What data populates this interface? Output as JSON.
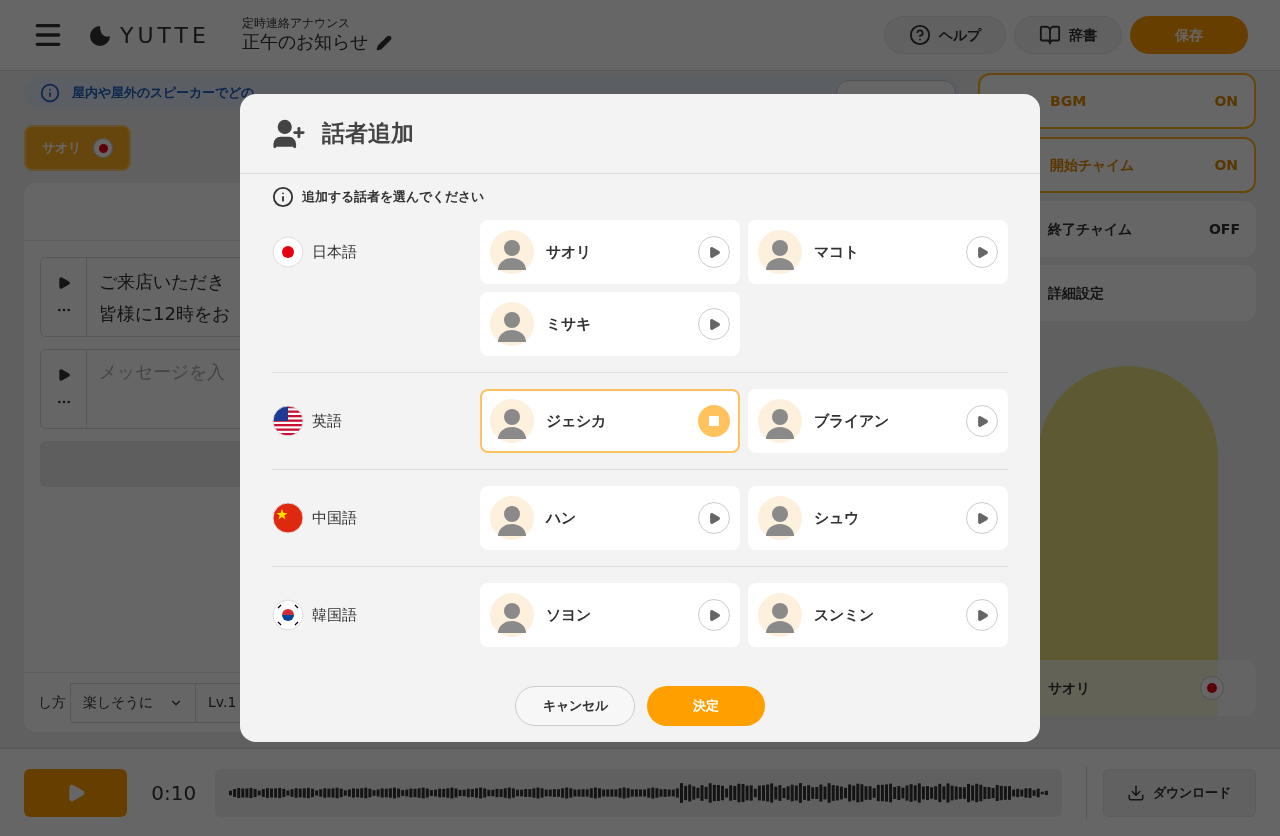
{
  "header": {
    "app_name": "YUTTE",
    "subtitle": "定時連絡アナウンス",
    "title": "正午のお知らせ",
    "buttons": [
      {
        "label": "ヘルプ",
        "kind": "help"
      },
      {
        "label": "辞書",
        "kind": "dictionary"
      },
      {
        "label": "保存",
        "kind": "primary"
      }
    ]
  },
  "info_banner": {
    "text": "屋内や屋外のスピーカーでどの"
  },
  "speaker_tabs": [
    {
      "label": "サオリ",
      "selected": true
    }
  ],
  "messages": [
    {
      "lines": [
        "ご来店いただき",
        "皆様に12時をお"
      ]
    },
    {
      "placeholder": "メッセージを入"
    }
  ],
  "style_bar": {
    "label": "し方",
    "style": "楽しそうに",
    "intensity": "Lv.1"
  },
  "settings": [
    {
      "label": "BGM",
      "value": "ON",
      "on": true
    },
    {
      "label": "開始チャイム",
      "value": "ON",
      "on": true
    },
    {
      "label": "終了チャイム",
      "value": "OFF",
      "on": false
    },
    {
      "label": "詳細設定"
    }
  ],
  "character_card": {
    "name": "サオリ"
  },
  "player": {
    "time": "0:10",
    "download": "ダウンロード"
  },
  "dialog": {
    "title": "話者追加",
    "hint": "追加する話者を選んでください",
    "groups": [
      {
        "language": "日本語",
        "flag": {
          "kind": "jp"
        },
        "speakers": [
          {
            "name": "サオリ",
            "playing": false
          },
          {
            "name": "マコト",
            "playing": false
          },
          {
            "name": "ミサキ",
            "playing": false
          }
        ]
      },
      {
        "language": "英語",
        "flag": {
          "kind": "us"
        },
        "speakers": [
          {
            "name": "ジェシカ",
            "playing": true
          },
          {
            "name": "ブライアン",
            "playing": false
          }
        ]
      },
      {
        "language": "中国語",
        "flag": {
          "kind": "cn"
        },
        "speakers": [
          {
            "name": "ハン",
            "playing": false
          },
          {
            "name": "シュウ",
            "playing": false
          }
        ]
      },
      {
        "language": "韓国語",
        "flag": {
          "kind": "kr"
        },
        "speakers": [
          {
            "name": "ソヨン",
            "playing": false
          },
          {
            "name": "スンミン",
            "playing": false
          }
        ]
      }
    ],
    "cancel": "キャンセル",
    "confirm": "決定"
  }
}
